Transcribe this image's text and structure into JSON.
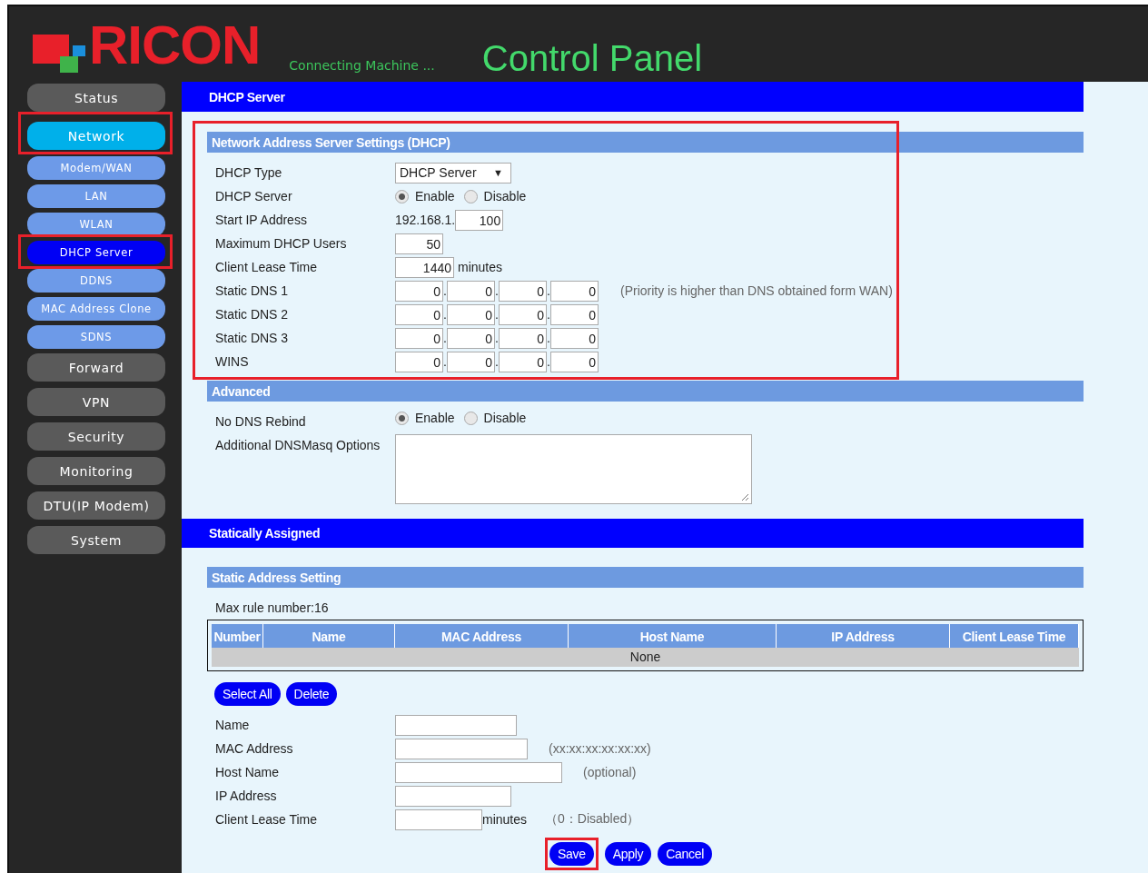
{
  "brand": {
    "logo_text": "RICON",
    "tagline": "Connecting Machine ...",
    "title": "Control Panel"
  },
  "sidebar": {
    "items": [
      {
        "label": "Status",
        "kind": "main",
        "selected": false,
        "highlighted": false
      },
      {
        "label": "Network",
        "kind": "main",
        "selected": true,
        "highlighted": true
      },
      {
        "label": "Modem/WAN",
        "kind": "sub",
        "selected": false,
        "highlighted": false
      },
      {
        "label": "LAN",
        "kind": "sub",
        "selected": false,
        "highlighted": false
      },
      {
        "label": "WLAN",
        "kind": "sub",
        "selected": false,
        "highlighted": false
      },
      {
        "label": "DHCP Server",
        "kind": "sub",
        "selected": true,
        "highlighted": true
      },
      {
        "label": "DDNS",
        "kind": "sub",
        "selected": false,
        "highlighted": false
      },
      {
        "label": "MAC Address Clone",
        "kind": "sub",
        "selected": false,
        "highlighted": false
      },
      {
        "label": "SDNS",
        "kind": "sub",
        "selected": false,
        "highlighted": false
      },
      {
        "label": "Forward",
        "kind": "main",
        "selected": false,
        "highlighted": false
      },
      {
        "label": "VPN",
        "kind": "main",
        "selected": false,
        "highlighted": false
      },
      {
        "label": "Security",
        "kind": "main",
        "selected": false,
        "highlighted": false
      },
      {
        "label": "Monitoring",
        "kind": "main",
        "selected": false,
        "highlighted": false
      },
      {
        "label": "DTU(IP Modem)",
        "kind": "main",
        "selected": false,
        "highlighted": false
      },
      {
        "label": "System",
        "kind": "main",
        "selected": false,
        "highlighted": false
      }
    ]
  },
  "page_title": "DHCP Server",
  "dhcp": {
    "title": "Network Address Server Settings (DHCP)",
    "highlighted": true,
    "fields": [
      {
        "kind": "select",
        "label": "DHCP Type",
        "value": "DHCP Server",
        "caret": "▼"
      },
      {
        "kind": "radio",
        "label": "DHCP Server",
        "options": [
          {
            "label": "Enable",
            "selected": true
          },
          {
            "label": "Disable",
            "selected": false
          }
        ]
      },
      {
        "kind": "prefixed",
        "label": "Start IP Address",
        "prefix": "192.168.1.",
        "value": "100"
      },
      {
        "kind": "number",
        "label": "Maximum DHCP Users",
        "value": "50"
      },
      {
        "kind": "number",
        "label": "Client Lease Time",
        "value": "1440",
        "unit": "minutes"
      },
      {
        "kind": "ip",
        "label": "Static DNS 1",
        "octets": [
          "0",
          "0",
          "0",
          "0"
        ],
        "separator": ".",
        "note": "(Priority is higher than DNS obtained form WAN)"
      },
      {
        "kind": "ip",
        "label": "Static DNS 2",
        "octets": [
          "0",
          "0",
          "0",
          "0"
        ],
        "separator": "."
      },
      {
        "kind": "ip",
        "label": "Static DNS 3",
        "octets": [
          "0",
          "0",
          "0",
          "0"
        ],
        "separator": "."
      },
      {
        "kind": "ip",
        "label": "WINS",
        "octets": [
          "0",
          "0",
          "0",
          "0"
        ],
        "separator": "."
      }
    ]
  },
  "advanced": {
    "title": "Advanced",
    "fields": [
      {
        "kind": "radio",
        "label": "No DNS Rebind",
        "options": [
          {
            "label": "Enable",
            "selected": true
          },
          {
            "label": "Disable",
            "selected": false
          }
        ]
      },
      {
        "kind": "textarea",
        "label": "Additional DNSMasq Options"
      }
    ]
  },
  "static": {
    "title": "Statically Assigned",
    "subtitle": "Static Address Setting",
    "max_rule": "Max rule number:16",
    "table": {
      "columns": [
        "Number",
        "Name",
        "MAC Address",
        "Host Name",
        "IP Address",
        "Client Lease Time"
      ],
      "empty_text": "None"
    },
    "actions": [
      "Select All",
      "Delete"
    ],
    "fields": [
      {
        "label": "Name"
      },
      {
        "label": "MAC Address",
        "note": "(xx:xx:xx:xx:xx:xx)"
      },
      {
        "label": "Host Name",
        "note": "(optional)"
      },
      {
        "label": "IP Address"
      },
      {
        "label": "Client Lease Time",
        "unit": "minutes",
        "note": "（0：Disabled）"
      }
    ]
  },
  "buttons": [
    {
      "label": "Save",
      "highlighted": true
    },
    {
      "label": "Apply",
      "highlighted": false
    },
    {
      "label": "Cancel",
      "highlighted": false
    }
  ]
}
